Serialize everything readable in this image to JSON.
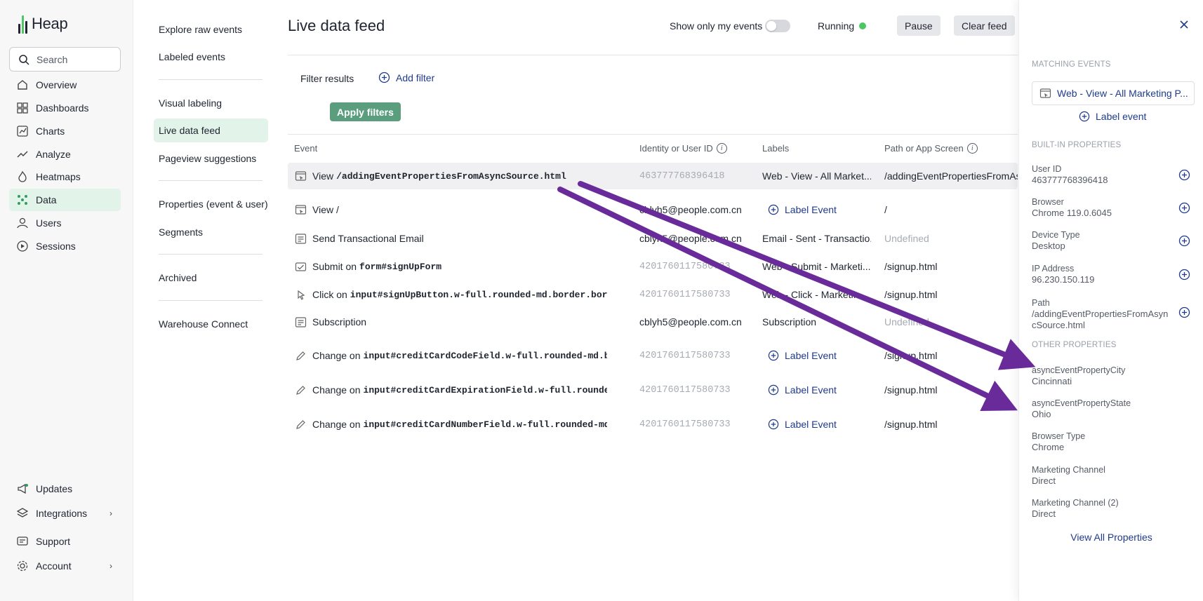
{
  "app": {
    "name": "Heap"
  },
  "search": {
    "placeholder": "Search"
  },
  "nav": {
    "items": [
      {
        "label": "Overview",
        "icon": "home-icon"
      },
      {
        "label": "Dashboards",
        "icon": "grid-icon"
      },
      {
        "label": "Charts",
        "icon": "chart-icon"
      },
      {
        "label": "Analyze",
        "icon": "analyze-icon"
      },
      {
        "label": "Heatmaps",
        "icon": "flame-icon"
      },
      {
        "label": "Data",
        "icon": "data-icon",
        "active": true
      },
      {
        "label": "Users",
        "icon": "user-icon"
      },
      {
        "label": "Sessions",
        "icon": "play-icon"
      }
    ],
    "bottom": [
      {
        "label": "Updates",
        "icon": "megaphone-icon"
      },
      {
        "label": "Integrations",
        "icon": "layers-icon"
      },
      {
        "label": "Support",
        "icon": "support-icon"
      },
      {
        "label": "Account",
        "icon": "gear-icon"
      }
    ]
  },
  "subnav": {
    "items": [
      "Explore raw events",
      "Labeled events",
      "Visual labeling",
      "Live data feed",
      "Pageview suggestions",
      "Properties (event & user)",
      "Segments",
      "Archived",
      "Warehouse Connect"
    ],
    "active": "Live data feed"
  },
  "header": {
    "title": "Live data feed",
    "toggle_label": "Show only my events",
    "status": "Running",
    "pause": "Pause",
    "clear": "Clear feed"
  },
  "filters": {
    "label": "Filter results",
    "add": "Add filter",
    "apply": "Apply filters"
  },
  "table": {
    "columns": [
      "Event",
      "Identity or User ID",
      "Labels",
      "Path or App Screen"
    ],
    "rows": [
      {
        "action": "View",
        "target": "/addingEventPropertiesFromAsyncSource.html",
        "identity": "463777768396418",
        "label": "Web - View - All Market...",
        "path": "/addingEventPropertiesFromAsy"
      },
      {
        "action": "View /",
        "target": "",
        "identity": "cblyh5@people.com.cn",
        "label": "Label Event",
        "path": "/"
      },
      {
        "action": "Send Transactional Email",
        "target": "",
        "identity": "cblyh5@people.com.cn",
        "label": "Email - Sent - Transactio...",
        "path": "Undefined"
      },
      {
        "action": "Submit on",
        "target": "form#signUpForm",
        "identity": "4201760117580733",
        "label": "Web - Submit - Marketi...",
        "path": "/signup.html"
      },
      {
        "action": "Click on",
        "target": "input#signUpButton.w-full.rounded-md.border.bordder-pri...",
        "identity": "4201760117580733",
        "label": "Web - Click - Marketi...",
        "path": "/signup.html"
      },
      {
        "action": "Subscription",
        "target": "",
        "identity": "cblyh5@people.com.cn",
        "label": "Subscription",
        "path": "Undefined"
      },
      {
        "action": "Change on",
        "target": "input#creditCardCodeField.w-full.rounded-md.border.b...",
        "identity": "4201760117580733",
        "label": "Label Event",
        "path": "/signup.html"
      },
      {
        "action": "Change on",
        "target": "input#creditCardExpirationField.w-full.rounded-md.bo...",
        "identity": "4201760117580733",
        "label": "Label Event",
        "path": "/signup.html"
      },
      {
        "action": "Change on",
        "target": "input#creditCardNumberField.w-full.rounded-md.border...",
        "identity": "4201760117580733",
        "label": "Label Event",
        "path": "/signup.html"
      }
    ]
  },
  "panel": {
    "matching_head": "MATCHING EVENTS",
    "matching_event": "Web - View - All Marketing P...",
    "label_event": "Label event",
    "builtin_head": "BUILT-IN PROPERTIES",
    "builtin": [
      {
        "key": "User ID",
        "value": "463777768396418"
      },
      {
        "key": "Browser",
        "value": "Chrome 119.0.6045"
      },
      {
        "key": "Device Type",
        "value": "Desktop"
      },
      {
        "key": "IP Address",
        "value": "96.230.150.119"
      },
      {
        "key": "Path",
        "value": "/addingEventPropertiesFromAsyncSource.html"
      }
    ],
    "other_head": "OTHER PROPERTIES",
    "other": [
      {
        "key": "asyncEventPropertyCity",
        "value": "Cincinnati"
      },
      {
        "key": "asyncEventPropertyState",
        "value": "Ohio"
      },
      {
        "key": "Browser Type",
        "value": "Chrome"
      },
      {
        "key": "Marketing Channel",
        "value": "Direct"
      },
      {
        "key": "Marketing Channel (2)",
        "value": "Direct"
      }
    ],
    "view_all": "View All Properties"
  },
  "colors": {
    "accent": "#1f3a8c",
    "active_bg": "#e2f3ea",
    "apply_btn": "#5b9e7e",
    "running_dot": "#4cc764",
    "annotation_arrow": "#6a2b9a"
  }
}
